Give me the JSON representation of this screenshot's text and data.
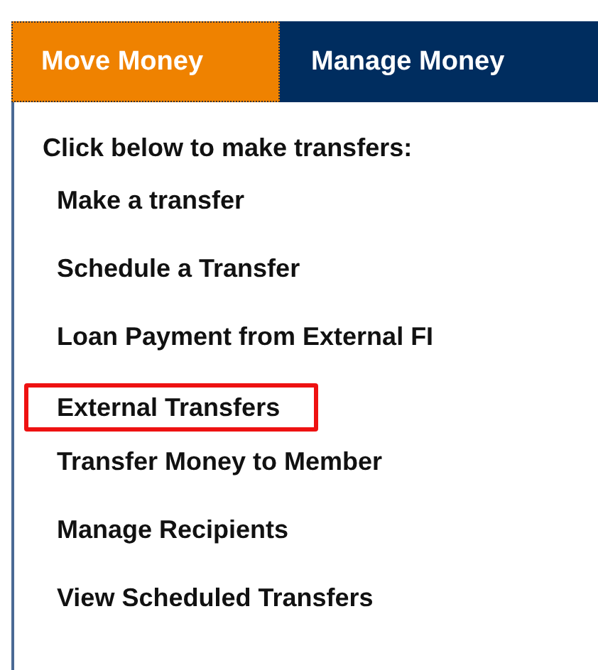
{
  "tabs": [
    {
      "label": "Move Money",
      "selected": true
    },
    {
      "label": "Manage Money",
      "selected": false
    }
  ],
  "menu": {
    "heading": "Click below to make transfers:",
    "items": [
      {
        "label": "Make a transfer",
        "highlighted": false
      },
      {
        "label": "Schedule a Transfer",
        "highlighted": false
      },
      {
        "label": "Loan Payment from External FI",
        "highlighted": false
      },
      {
        "label": "External Transfers",
        "highlighted": true
      },
      {
        "label": "Transfer Money to Member",
        "highlighted": false
      },
      {
        "label": "Manage Recipients",
        "highlighted": false
      },
      {
        "label": "View Scheduled Transfers",
        "highlighted": false
      }
    ]
  }
}
